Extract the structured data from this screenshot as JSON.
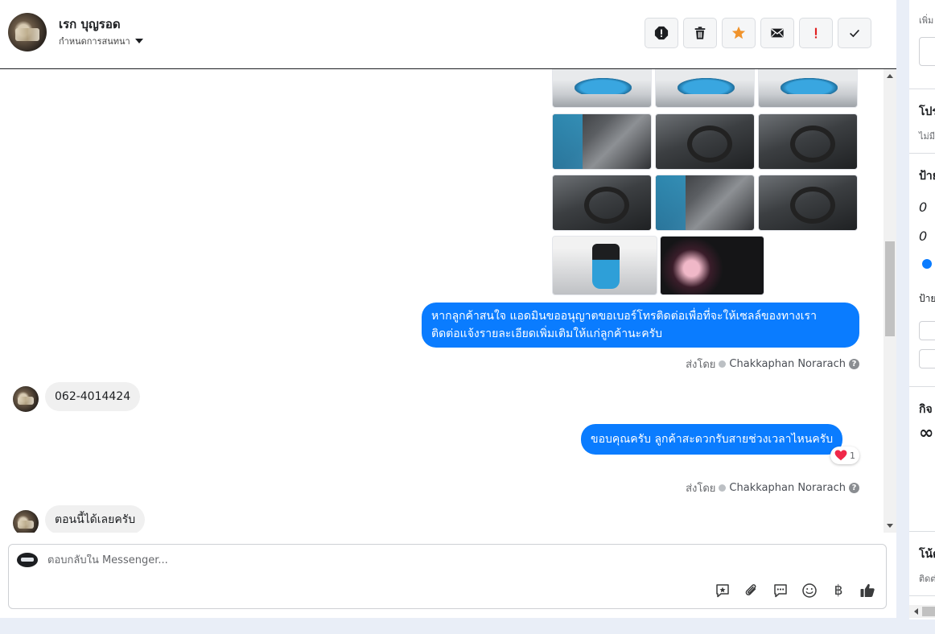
{
  "header": {
    "name": "เรก บุญรอด",
    "sub_label": "กำหนดการสนทนา"
  },
  "toolbar": {
    "buttons": [
      "report-icon",
      "trash-icon",
      "star-icon",
      "envelope-icon",
      "exclamation-icon",
      "check-icon"
    ],
    "accent_star": "#f0932b",
    "accent_alert": "#e02020"
  },
  "messages": [
    {
      "direction": "out",
      "text_line1": "หากลูกค้าสนใจ แอดมินขออนุญาตขอเบอร์โทรติดต่อเพื่อที่จะให้เซลล์ของทางเรา",
      "text_line2": "ติดต่อแจ้งรายละเอียดเพิ่มเติมให้แก่ลูกค้านะครับ"
    },
    {
      "sent_by_label": "ส่งโดย",
      "sent_by_name": "Chakkaphan Norarach"
    },
    {
      "direction": "in",
      "text": "062-4014424"
    },
    {
      "direction": "out",
      "text": "ขอบคุณครับ ลูกค้าสะดวกรับสายช่วงเวลาไหนครับ",
      "reaction_emoji": "❤️",
      "reaction_count": "1"
    },
    {
      "sent_by_label": "ส่งโดย",
      "sent_by_name": "Chakkaphan Norarach"
    },
    {
      "direction": "in",
      "text": "ตอนนี้ได้เลยครับ"
    }
  ],
  "composer": {
    "placeholder": "ตอบกลับใน Messenger...",
    "tools": [
      "saved-reply-icon",
      "attachment-icon",
      "chat-bubble-icon",
      "emoji-icon",
      "baht-icon",
      "like-icon"
    ],
    "baht_symbol": "฿"
  },
  "sidebar": {
    "t1": "เพิ่ม",
    "t2": "โปร",
    "t3": "ไม่มี",
    "t4": "ป้าย",
    "t5": "ป้าย",
    "t6": "กิจ",
    "t7": "∞",
    "t8": "โน้ต",
    "t9": "ติดต่อ"
  },
  "colors": {
    "outgoing_bubble": "#0a7cff",
    "incoming_bubble": "#f0f0f0"
  }
}
